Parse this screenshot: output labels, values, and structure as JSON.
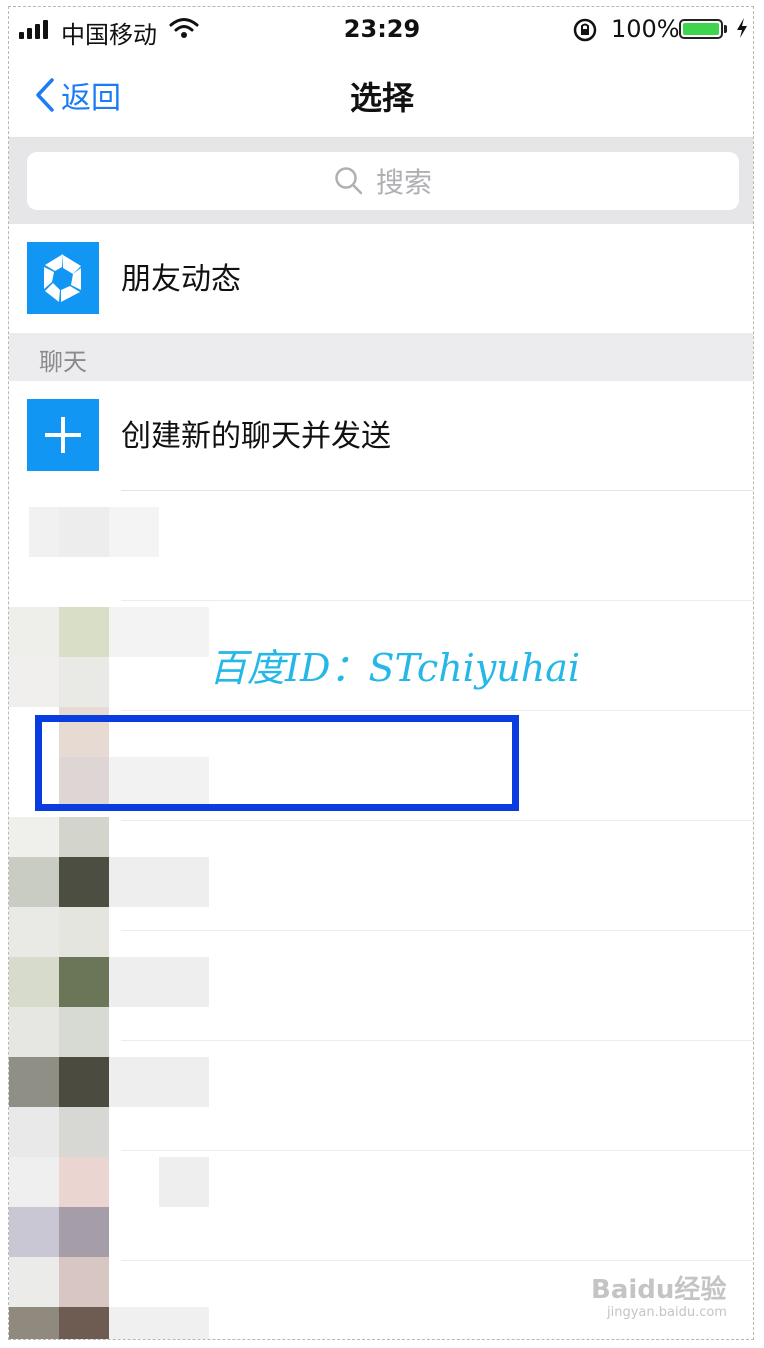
{
  "status_bar": {
    "carrier": "中国移动",
    "time": "23:29",
    "battery_percent": "100%",
    "battery_level": 1.0,
    "battery_color": "#3fd44e"
  },
  "nav": {
    "back_label": "返回",
    "title": "选择",
    "accent_color": "#1c7cf5"
  },
  "search": {
    "placeholder": "搜索"
  },
  "moments": {
    "label": "朋友动态",
    "icon": "aperture-icon"
  },
  "chat_section": {
    "header": "聊天",
    "new_chat_label": "创建新的聊天并发送",
    "new_chat_icon": "plus-icon"
  },
  "watermark": {
    "text": "百度ID：STchiyuhai",
    "color": "#23b8e8"
  },
  "baidu": {
    "logo": "Baidu经验",
    "url": "jingyan.baidu.com"
  }
}
